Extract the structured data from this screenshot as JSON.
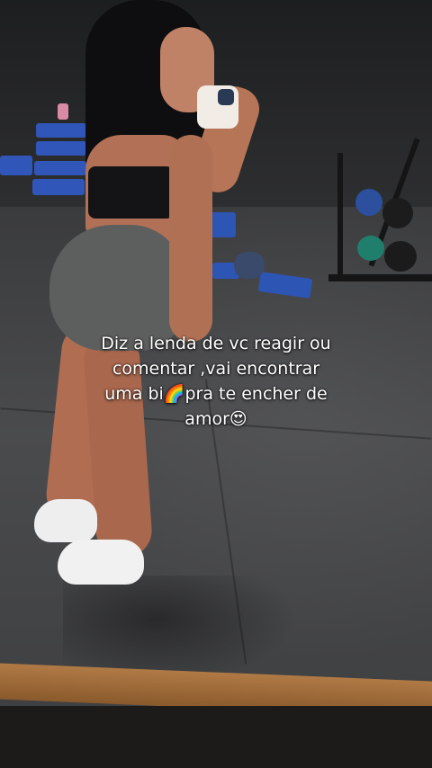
{
  "caption": {
    "line1": "Diz a lenda de vc reagir ou",
    "line2": "comentar ,vai encontrar",
    "line3": "uma bi🌈pra te encher de",
    "line4": "amor😍"
  }
}
